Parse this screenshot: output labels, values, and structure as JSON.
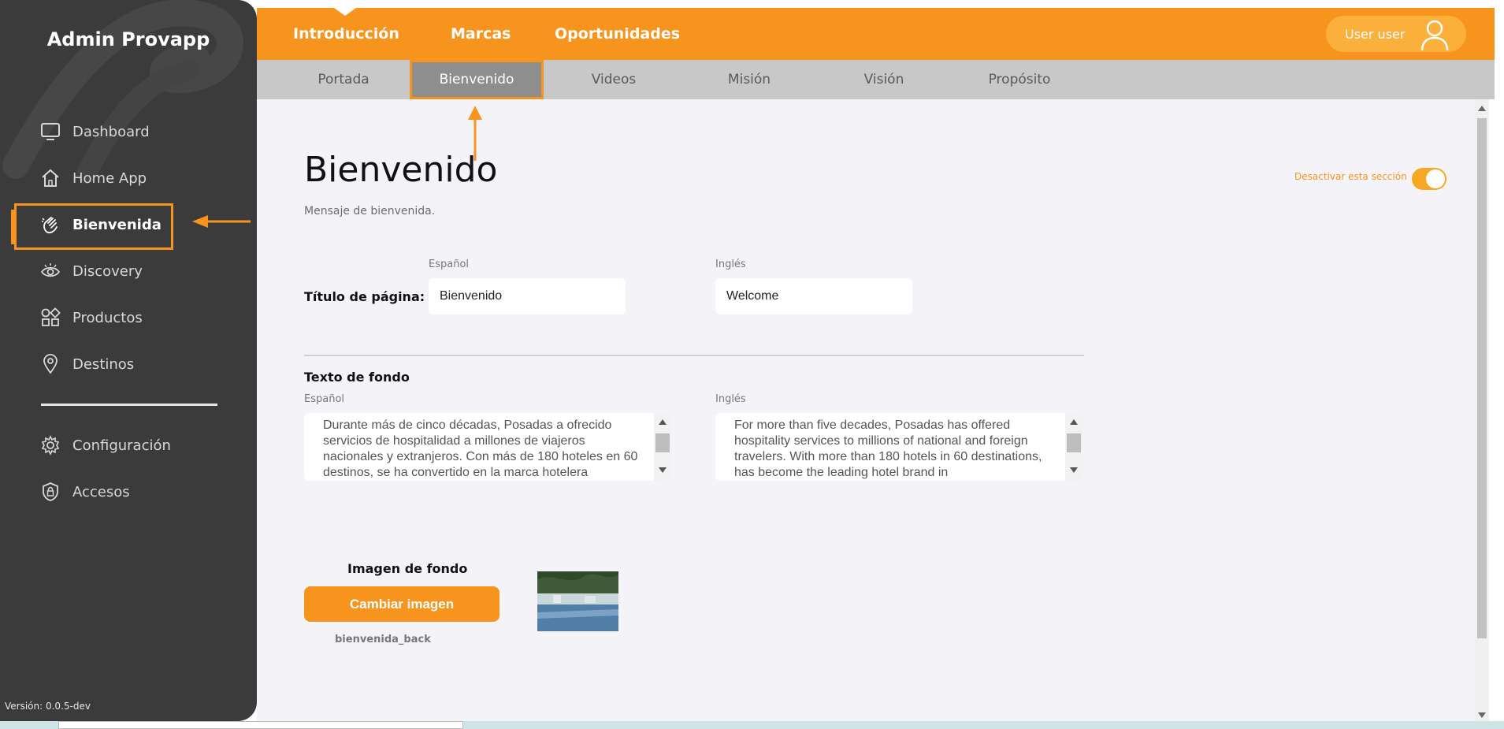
{
  "sidebar": {
    "title": "Admin Provapp",
    "items": [
      {
        "label": "Dashboard",
        "icon": "monitor-icon"
      },
      {
        "label": "Home App",
        "icon": "home-icon"
      },
      {
        "label": "Bienvenida",
        "icon": "waving-hand-icon"
      },
      {
        "label": "Discovery",
        "icon": "eye-icon"
      },
      {
        "label": "Productos",
        "icon": "grid-shapes-icon"
      },
      {
        "label": "Destinos",
        "icon": "location-pin-icon"
      },
      {
        "label": "Configuración",
        "icon": "gear-icon"
      },
      {
        "label": "Accesos",
        "icon": "shield-lock-icon"
      }
    ],
    "active_item": "Bienvenida",
    "version": "Versión: 0.0.5-dev"
  },
  "topbar": {
    "tabs": [
      "Introducción",
      "Marcas",
      "Oportunidades"
    ],
    "user_label": "User user",
    "accent_color": "#f7941d"
  },
  "subtabs": {
    "items": [
      "Portada",
      "Bienvenido",
      "Videos",
      "Misión",
      "Visión",
      "Propósito"
    ],
    "active": "Bienvenido"
  },
  "page": {
    "title": "Bienvenido",
    "subtitle": "Mensaje de bienvenida.",
    "toggle_label": "Desactivar esta sección",
    "toggle_on": true
  },
  "form": {
    "lang_es": "Español",
    "lang_en": "Inglés",
    "page_title_label": "Título de página:",
    "page_title_es": "Bienvenido",
    "page_title_en": "Welcome",
    "background_text_label": "Texto de fondo",
    "background_text_es": "Durante más de cinco décadas, Posadas a ofrecido servicios de hospitalidad a millones de viajeros nacionales y extranjeros. Con más de 180 hoteles en 60 destinos, se ha convertido en la marca hotelera",
    "background_text_en": "For more than five decades, Posadas has offered hospitality services to millions of national and foreign travelers. With more than 180 hotels in 60 destinations, has become the leading hotel brand in",
    "background_image_label": "Imagen de fondo",
    "change_image_button": "Cambiar imagen",
    "image_filename": "bienvenida_back"
  }
}
